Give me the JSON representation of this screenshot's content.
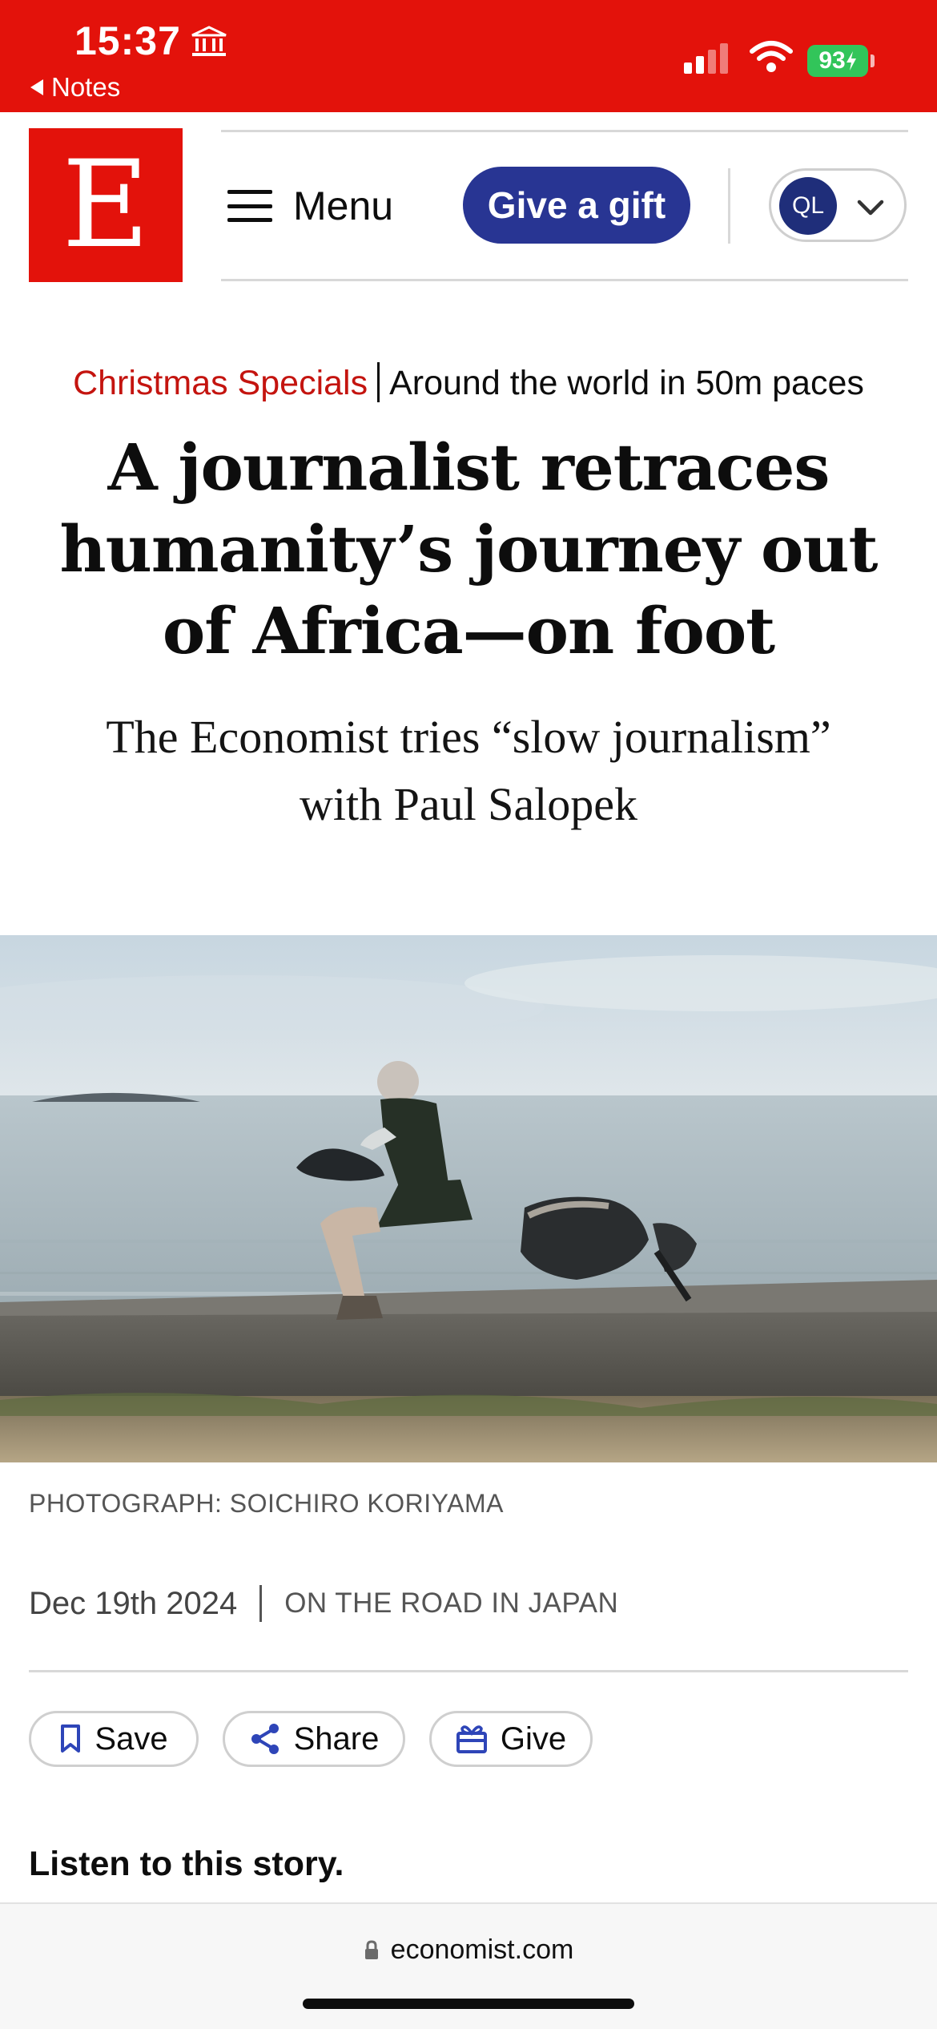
{
  "status_bar": {
    "time": "15:37",
    "back_label": "Notes",
    "battery": "93"
  },
  "header": {
    "logo_letter": "E",
    "menu_label": "Menu",
    "gift_label": "Give a gift",
    "account_initials": "QL"
  },
  "article": {
    "section": "Christmas Specials",
    "series": "Around the world in 50m paces",
    "headline": "A journalist retraces humanity’s journey out of Africa—on foot",
    "subheadline": "The Economist tries “slow journalism” with Paul Salopek",
    "photo_credit": "PHOTOGRAPH: SOICHIRO KORIYAMA",
    "date": "Dec 19th 2024",
    "location": "ON THE ROAD IN JAPAN"
  },
  "actions": {
    "save_label": "Save",
    "share_label": "Share",
    "give_label": "Give"
  },
  "listen_label": "Listen to this story.",
  "browser": {
    "url": "economist.com"
  },
  "colors": {
    "brand_red": "#e3120b",
    "gift_blue": "#283593",
    "icon_blue": "#2e45b8"
  }
}
